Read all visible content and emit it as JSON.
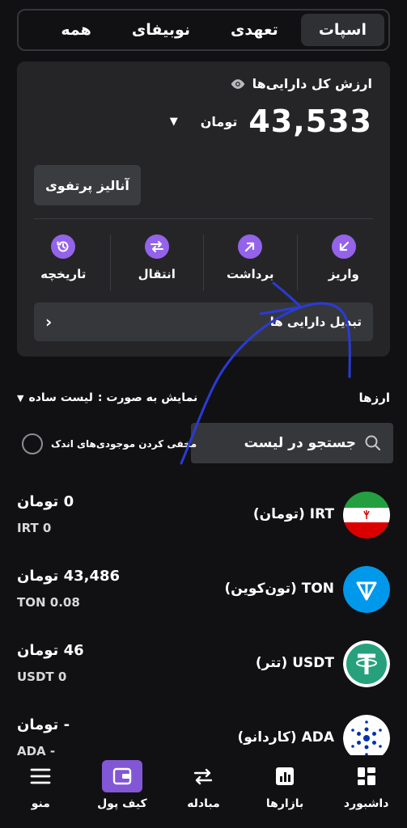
{
  "tabs": [
    {
      "label": "اسپات",
      "active": true
    },
    {
      "label": "تعهدی",
      "active": false
    },
    {
      "label": "نوبیفای",
      "active": false
    },
    {
      "label": "همه",
      "active": false
    }
  ],
  "wallet": {
    "total_label": "ارزش کل دارایی‌ها",
    "total_value": "43,533",
    "total_unit": "تومان",
    "portfolio_button": "آنالیز پرتفوی",
    "actions": [
      {
        "label": "واریز",
        "icon": "deposit-arrow-icon"
      },
      {
        "label": "برداشت",
        "icon": "withdraw-arrow-icon"
      },
      {
        "label": "انتقال",
        "icon": "transfer-icon"
      },
      {
        "label": "تاریخچه",
        "icon": "history-icon"
      }
    ],
    "convert_label": "تبدیل دارایی ها"
  },
  "assets": {
    "title": "ارزها",
    "view_mode_label": "نمایش به صورت :",
    "view_mode_value": "لیست ساده",
    "search_placeholder": "جستجو در لیست",
    "hide_small_label": "مخفی کردن موجودی‌های اندک",
    "coins": [
      {
        "name": "IRT (تومان)",
        "fiat": "0 تومان",
        "amount": "IRT 0"
      },
      {
        "name": "TON (تون‌کوین)",
        "fiat": "43,486 تومان",
        "amount": "TON 0.08"
      },
      {
        "name": "USDT (تتر)",
        "fiat": "46 تومان",
        "amount": "USDT 0"
      },
      {
        "name": "ADA (کاردانو)",
        "fiat": "- تومان",
        "amount": "ADA -"
      }
    ]
  },
  "bottom_nav": [
    {
      "label": "داشبورد",
      "icon": "dashboard-icon",
      "active": false
    },
    {
      "label": "بازارها",
      "icon": "markets-icon",
      "active": false
    },
    {
      "label": "مبادله",
      "icon": "exchange-icon",
      "active": false
    },
    {
      "label": "کیف پول",
      "icon": "wallet-icon",
      "active": true
    },
    {
      "label": "منو",
      "icon": "menu-icon",
      "active": false
    }
  ],
  "colors": {
    "accent": "#9463ea",
    "background": "#111113",
    "card": "#252528",
    "annotation_stroke": "#2a3bd6"
  }
}
